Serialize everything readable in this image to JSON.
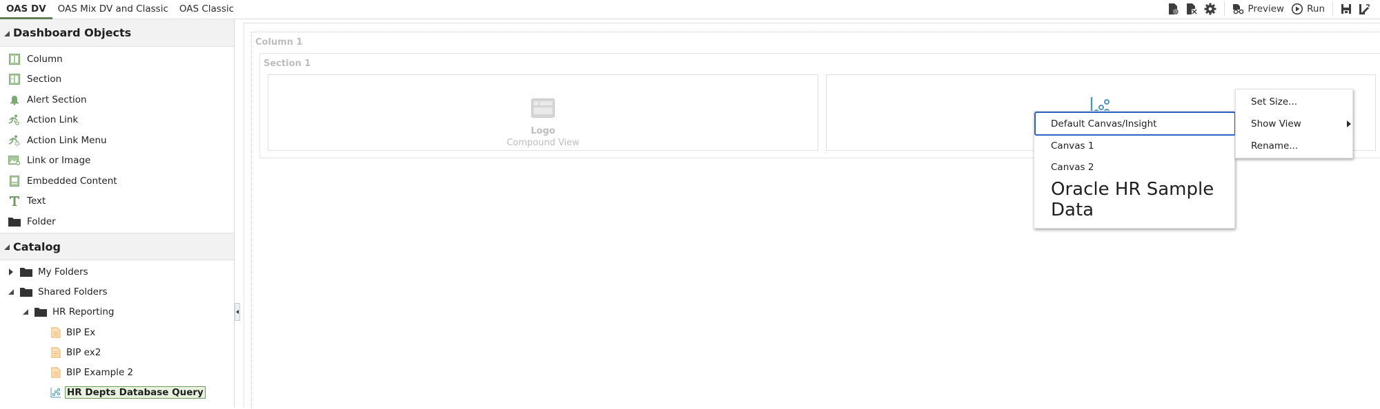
{
  "tabs": [
    {
      "label": "OAS DV",
      "active": true
    },
    {
      "label": "OAS Mix DV and Classic",
      "active": false
    },
    {
      "label": "OAS Classic",
      "active": false
    }
  ],
  "toolbar": {
    "new_page_icon": "page-add-icon",
    "delete_page_icon": "page-delete-icon",
    "settings_icon": "gear-icon",
    "preview_label": "Preview",
    "run_label": "Run",
    "save_icon": "save-icon",
    "save_as_icon": "save-as-icon"
  },
  "dashboard_objects": {
    "title": "Dashboard Objects",
    "items": [
      {
        "label": "Column",
        "icon": "column-icon"
      },
      {
        "label": "Section",
        "icon": "section-icon"
      },
      {
        "label": "Alert Section",
        "icon": "bell-icon"
      },
      {
        "label": "Action Link",
        "icon": "action-link-icon"
      },
      {
        "label": "Action Link Menu",
        "icon": "action-link-menu-icon"
      },
      {
        "label": "Link or Image",
        "icon": "image-link-icon"
      },
      {
        "label": "Embedded Content",
        "icon": "embedded-content-icon"
      },
      {
        "label": "Text",
        "icon": "text-icon"
      },
      {
        "label": "Folder",
        "icon": "folder-icon"
      }
    ]
  },
  "catalog": {
    "title": "Catalog",
    "tree": [
      {
        "label": "My Folders",
        "level": 0,
        "expanded": false,
        "type": "folder"
      },
      {
        "label": "Shared Folders",
        "level": 0,
        "expanded": true,
        "type": "folder"
      },
      {
        "label": "HR Reporting",
        "level": 1,
        "expanded": true,
        "type": "folder"
      },
      {
        "label": "BIP Ex",
        "level": 2,
        "type": "report"
      },
      {
        "label": "BIP ex2",
        "level": 2,
        "type": "report"
      },
      {
        "label": "BIP Example 2",
        "level": 2,
        "type": "report"
      },
      {
        "label": "HR Depts Database Query",
        "level": 2,
        "type": "workbook",
        "selected": true
      }
    ]
  },
  "canvas": {
    "column_label": "Column 1",
    "section_label": "Section 1",
    "logo_view": {
      "title": "Logo",
      "subtitle": "Compound View"
    }
  },
  "canvas_dropdown": {
    "items": [
      {
        "label": "Default Canvas/Insight",
        "focused": true
      },
      {
        "label": "Canvas 1"
      },
      {
        "label": "Canvas 2"
      },
      {
        "label": "Oracle HR Sample Data"
      }
    ]
  },
  "context_menu": {
    "items": [
      {
        "label": "Set Size..."
      },
      {
        "label": "Show View",
        "has_submenu": true
      },
      {
        "label": "Rename..."
      }
    ]
  },
  "colors": {
    "active_tab_underline": "#5b7f52",
    "object_icon_green": "#7fa874",
    "report_icon_orange": "#f4b36a",
    "workbook_icon_blue": "#4f97b8",
    "focus_blue": "#2d62c5"
  }
}
